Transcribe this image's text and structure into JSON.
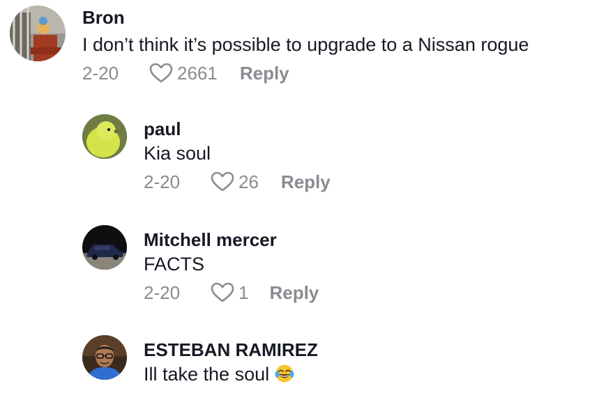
{
  "comments": [
    {
      "username": "Bron",
      "text": "I don’t think it’s possible to upgrade to a Nissan rogue",
      "date": "2-20",
      "likes": "2661",
      "reply_label": "Reply",
      "avatar_icon": "porch-figure-avatar"
    },
    {
      "username": "paul",
      "text": "Kia soul",
      "date": "2-20",
      "likes": "26",
      "reply_label": "Reply",
      "avatar_icon": "yellow-bird-avatar"
    },
    {
      "username": "Mitchell mercer",
      "text": "FACTS",
      "date": "2-20",
      "likes": "1",
      "reply_label": "Reply",
      "avatar_icon": "dark-car-avatar"
    },
    {
      "username": "ESTEBAN RAMIREZ",
      "text": "Ill take the soul",
      "emoji": "tears-of-joy-emoji",
      "avatar_icon": "man-glasses-avatar"
    }
  ],
  "colors": {
    "text": "#161823",
    "meta": "#8a8b91",
    "heart_outline": "#8a8b91"
  }
}
